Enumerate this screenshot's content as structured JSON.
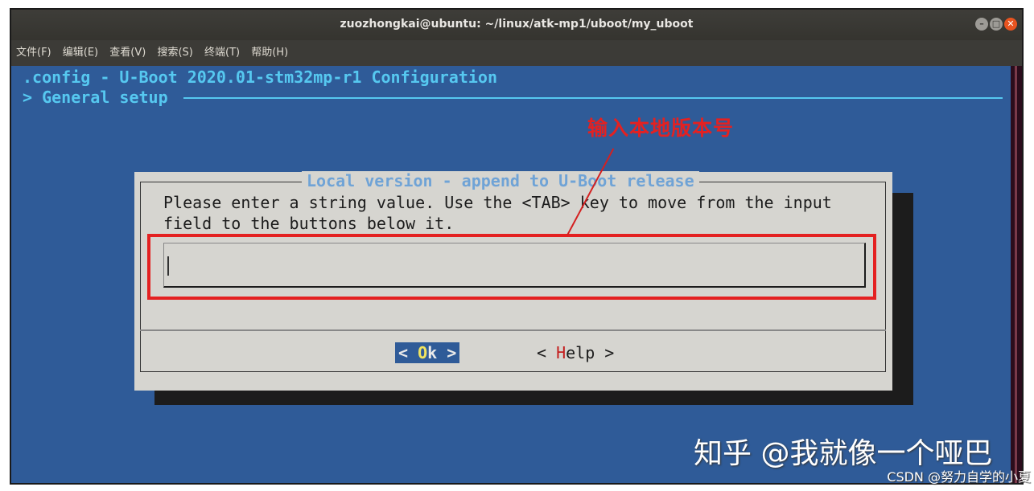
{
  "window": {
    "title": "zuozhongkai@ubuntu: ~/linux/atk-mp1/uboot/my_uboot",
    "controls": {
      "minimize": "–",
      "maximize": "□",
      "close": "✕"
    }
  },
  "menubar": {
    "items": [
      "文件(F)",
      "编辑(E)",
      "查看(V)",
      "搜索(S)",
      "终端(T)",
      "帮助(H)"
    ]
  },
  "terminal": {
    "config_title": ".config - U-Boot 2020.01-stm32mp-r1 Configuration",
    "breadcrumb": "> General setup"
  },
  "dialog": {
    "title": "Local version - append to U-Boot release",
    "prompt_line1": "Please enter a string value. Use the <TAB> key to move from the input",
    "prompt_line2": "field to the buttons below it.",
    "input_value": "",
    "ok_button": {
      "left": "< ",
      "hotkey": "O",
      "rest": "k",
      "right": " >"
    },
    "help_button": {
      "left": "< ",
      "hotkey": "H",
      "rest": "elp",
      "right": " >"
    }
  },
  "annotation": {
    "text": "输入本地版本号",
    "color": "#e42121"
  },
  "watermark": {
    "zhihu": "知乎 @我就像一个哑巴",
    "csdn": "CSDN @努力自学的小夏"
  },
  "colors": {
    "terminal_bg": "#2f5b98",
    "dialog_bg": "#d6d5d0",
    "accent_cyan": "#56c8f0",
    "ubuntu_orange": "#e95420"
  }
}
